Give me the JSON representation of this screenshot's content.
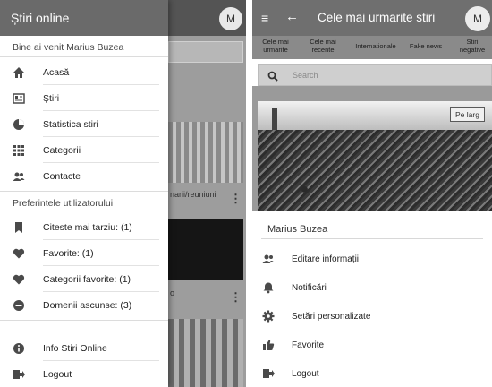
{
  "left_screen": {
    "background_app": {
      "avatar_letter": "M",
      "card1_caption": "narii/reuniuni",
      "card2_caption": "o",
      "more_dots": "⋮"
    },
    "drawer": {
      "title": "Știri online",
      "welcome": "Bine ai venit Marius Buzea",
      "main_items": [
        {
          "icon": "home-icon",
          "label": "Acasă"
        },
        {
          "icon": "news-icon",
          "label": "Știri"
        },
        {
          "icon": "pie-chart-icon",
          "label": "Statistica stiri"
        },
        {
          "icon": "grid-icon",
          "label": "Categorii"
        },
        {
          "icon": "contacts-icon",
          "label": "Contacte"
        }
      ],
      "preferences_header": "Preferintele utilizatorului",
      "pref_items": [
        {
          "icon": "bookmark-icon",
          "label": "Citeste mai tarziu: (1)"
        },
        {
          "icon": "heart-icon",
          "label": "Favorite: (1)"
        },
        {
          "icon": "heart-icon",
          "label": "Categorii favorite: (1)"
        },
        {
          "icon": "minus-circle-icon",
          "label": "Domenii ascunse: (3)"
        }
      ],
      "bottom_items": [
        {
          "icon": "info-icon",
          "label": "Info Stiri Online"
        },
        {
          "icon": "logout-icon",
          "label": "Logout"
        }
      ]
    }
  },
  "right_screen": {
    "appbar": {
      "menu_glyph": "≡",
      "back_glyph": "←",
      "title": "Cele mai urmarite stiri",
      "avatar_letter": "M"
    },
    "tabs": [
      {
        "line1": "Cele mai",
        "line2": "urmarite"
      },
      {
        "line1": "Cele mai",
        "line2": "recente"
      },
      {
        "line1": "Internationale",
        "line2": ""
      },
      {
        "line1": "Fake news",
        "line2": ""
      },
      {
        "line1": "Stiri",
        "line2": "negative"
      }
    ],
    "search_placeholder": "Search",
    "image_button": "Pe larg",
    "sheet": {
      "user_name": "Marius Buzea",
      "items": [
        {
          "icon": "edit-user-icon",
          "label": "Editare informații"
        },
        {
          "icon": "bell-icon",
          "label": "Notificări"
        },
        {
          "icon": "settings-icon",
          "label": "Setări personalizate"
        },
        {
          "icon": "thumbs-up-icon",
          "label": "Favorite"
        },
        {
          "icon": "logout-icon",
          "label": "Logout"
        }
      ]
    }
  },
  "colors": {
    "drawer_header": "#6a6a6a",
    "scrim": "#9d9d9d",
    "right_appbar": "#6f6f6f",
    "tabs_bar": "#8a8a8a",
    "icon": "#4a4a4a"
  }
}
